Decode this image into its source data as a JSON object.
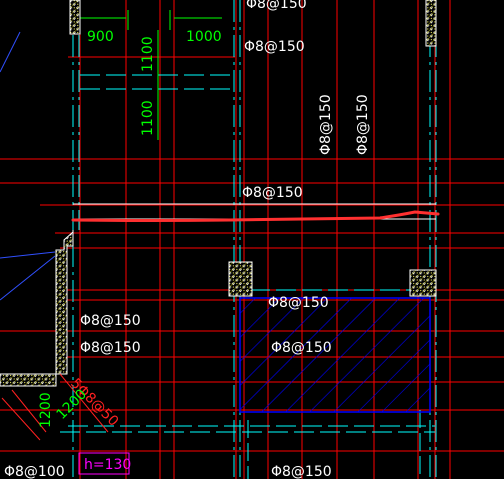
{
  "colors": {
    "background": "#000000",
    "gridline": "#ff0000",
    "axis": "#00ffff",
    "dimension": "#00ff00",
    "text": "#ffffff",
    "hatch": "#0000ff",
    "column_hatch": "#ffff00",
    "markup_stroke": "#ff3030",
    "tag": "#ff00ff"
  },
  "labels": {
    "rebar_top_partial": "Φ8@150",
    "rebar_top": "Φ8@150",
    "rebar_vertical_1": "Φ8@150",
    "rebar_vertical_2": "Φ8@150",
    "rebar_middle": "Φ8@150",
    "rebar_hatched_top": "Φ8@150",
    "rebar_left_1": "Φ8@150",
    "rebar_left_2": "Φ8@150",
    "rebar_hatched_mid": "Φ8@150",
    "rebar_bottom": "Φ8@150",
    "rebar_bottom_left": "Φ8@100",
    "rebar_diagonal": "5Φ8@50",
    "dim_900": "900",
    "dim_1000": "1000",
    "dim_1100_top": "1100",
    "dim_1100_bottom": "1100",
    "dim_1200_a": "1200",
    "dim_1200_b": "1200",
    "thickness_tag": "h=130"
  }
}
